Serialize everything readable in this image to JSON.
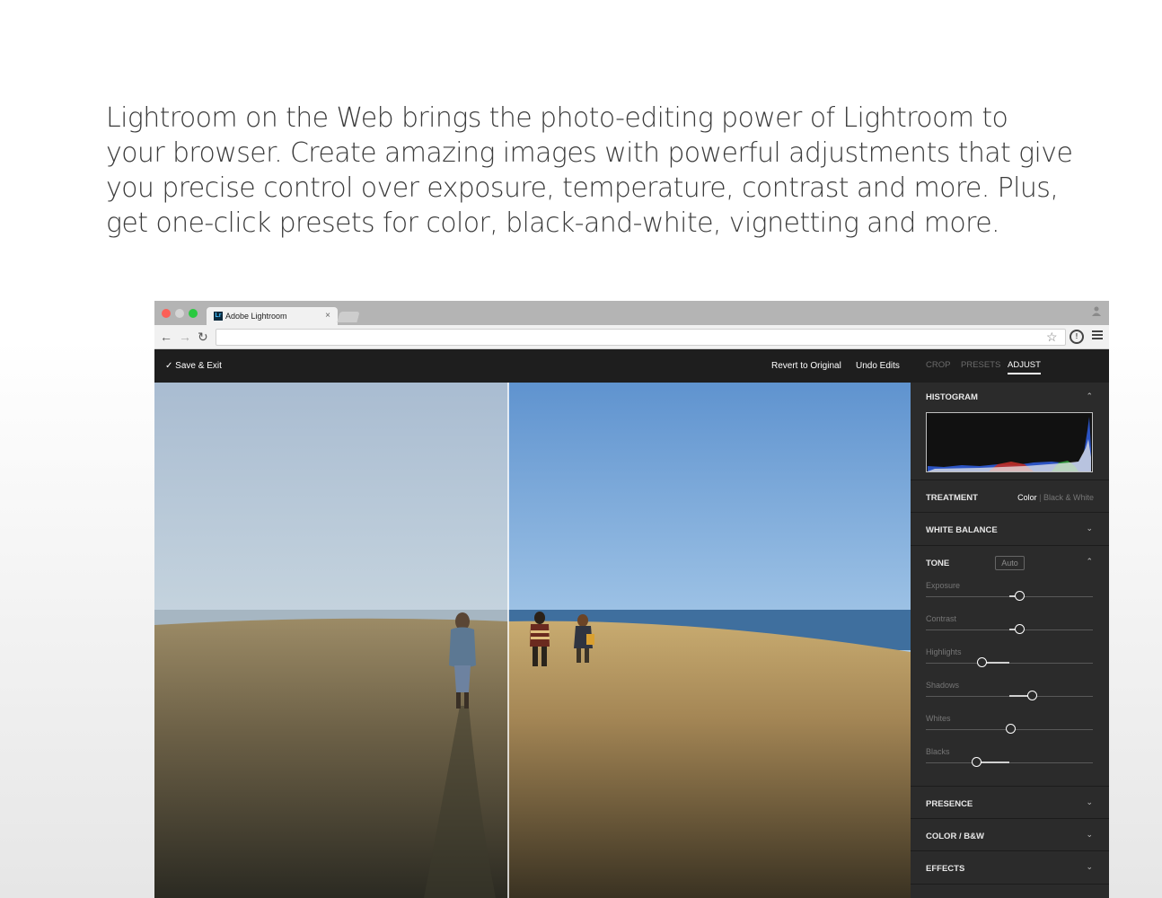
{
  "intro": {
    "lines": [
      "Lightroom on the Web brings the photo-editing power of Lightroom to",
      "your browser. Create amazing images with powerful adjustments that give",
      "you precise control over exposure, temperature, contrast and more. Plus,",
      "get one-click presets for color, black-and-white, vignetting and more."
    ]
  },
  "browser": {
    "tab_logo": "Lr",
    "tab_title": "Adobe Lightroom",
    "tab_close": "×",
    "url": ""
  },
  "app": {
    "save_exit": "Save & Exit",
    "revert": "Revert to Original",
    "undo": "Undo Edits"
  },
  "panel": {
    "tabs": [
      "CROP",
      "PRESETS",
      "ADJUST"
    ],
    "active_tab": "ADJUST",
    "histogram": "HISTOGRAM",
    "treatment": {
      "label": "TREATMENT",
      "color": "Color",
      "separator": "|",
      "bw": "Black & White",
      "selected": "Color"
    },
    "white_balance": "WHITE BALANCE",
    "tone": {
      "label": "TONE",
      "auto": "Auto",
      "sliders": [
        {
          "label": "Exposure",
          "value": 0.13
        },
        {
          "label": "Contrast",
          "value": 0.13
        },
        {
          "label": "Highlights",
          "value": -0.32
        },
        {
          "label": "Shadows",
          "value": 0.28
        },
        {
          "label": "Whites",
          "value": 0.02
        },
        {
          "label": "Blacks",
          "value": -0.39
        }
      ]
    },
    "presence": "PRESENCE",
    "color_bw": "COLOR / B&W",
    "effects": "EFFECTS"
  },
  "colors": {
    "panel_bg": "#2b2b2b",
    "app_bar_bg": "#1e1e1e",
    "histogram_blue": "#2f5bd6",
    "histogram_red": "#c0302a",
    "histogram_green": "#2e9a3a"
  }
}
